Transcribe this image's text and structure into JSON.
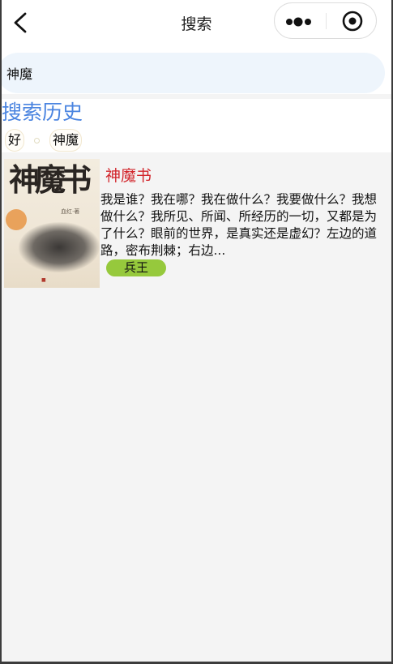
{
  "nav": {
    "title": "搜索",
    "back_icon": "chevron-left-icon",
    "more_icon": "more-dots-icon",
    "close_icon": "target-circle-icon"
  },
  "search": {
    "value": "神魔"
  },
  "history": {
    "title": "搜索历史",
    "tags": [
      "好",
      "神魔"
    ]
  },
  "results": [
    {
      "cover_title": "神魔书",
      "cover_author": "血红·著",
      "title": "神魔书",
      "description": "我是谁？我在哪？我在做什么？我要做什么？我想做什么？我所见、所闻、所经历的一切，又都是为了什么？眼前的世界，是真实还是虚幻？左边的道路，密布荆棘；右边...",
      "author": "兵王"
    }
  ],
  "colors": {
    "history_title": "#4a84e0",
    "book_title": "#d2262c",
    "author_badge": "#96c93c",
    "search_bg": "#eef5fc"
  }
}
